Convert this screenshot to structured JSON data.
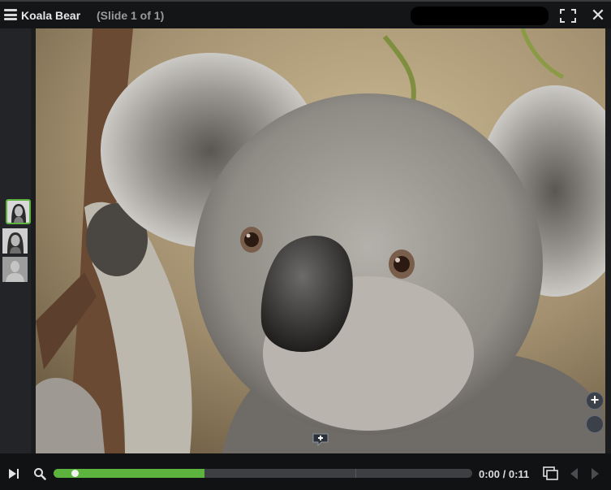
{
  "header": {
    "title": "Koala Bear",
    "slide_indicator": "(Slide 1 of 1)",
    "close_glyph": "✕"
  },
  "sidebar": {
    "participants": [
      {
        "icon": "participant-avatar",
        "active": true
      },
      {
        "icon": "participant-avatar",
        "active": false
      },
      {
        "icon": "placeholder-avatar",
        "active": false
      }
    ]
  },
  "stage": {
    "image": "koala-photo",
    "zoom_in_glyph": "+"
  },
  "player": {
    "time": "0:00 / 0:11",
    "progress_fraction": 0.36,
    "buffer_marker_fraction": 0.72
  },
  "colors": {
    "accent": "#5cb33e",
    "bar_bg": "#141517",
    "track_bg": "#3d3f43"
  }
}
